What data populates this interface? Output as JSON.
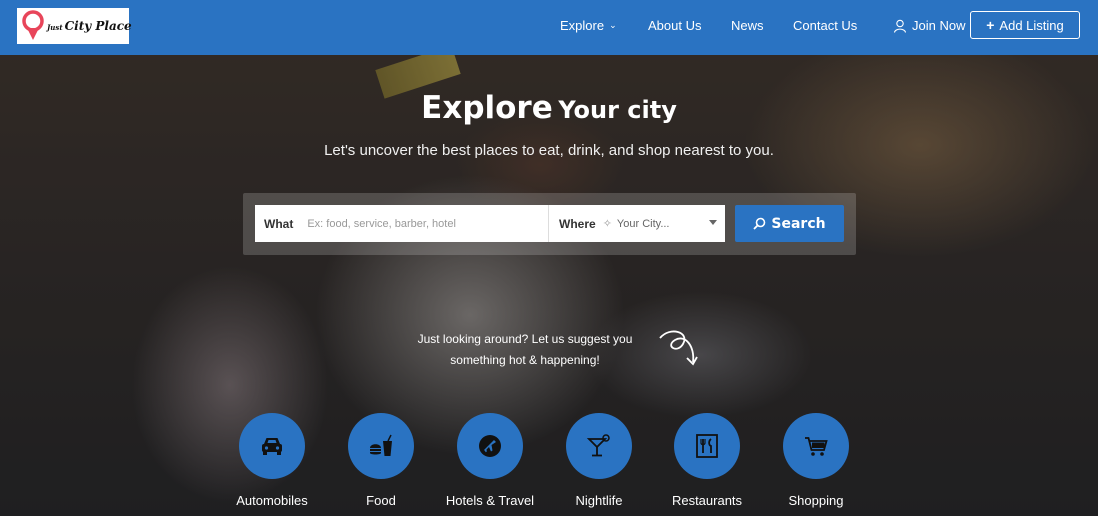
{
  "header": {
    "logo": {
      "small_text": "Just",
      "main_text": "City Place"
    },
    "nav": [
      {
        "label": "Explore"
      },
      {
        "label": "About Us"
      },
      {
        "label": "News"
      },
      {
        "label": "Contact Us"
      }
    ],
    "join_label": "Join Now",
    "add_listing_label": "Add Listing"
  },
  "hero": {
    "title_big": "Explore",
    "title_small": "Your city",
    "subtitle": "Let's uncover the best places to eat, drink, and shop nearest to you."
  },
  "search": {
    "what_label": "What",
    "what_placeholder": "Ex: food, service, barber, hotel",
    "where_label": "Where",
    "where_value": "Your City...",
    "button_label": "Search"
  },
  "suggest": {
    "line1": "Just looking around? Let us suggest you",
    "line2": "something hot & happening!"
  },
  "categories": [
    {
      "label": "Automobiles",
      "icon": "car-icon"
    },
    {
      "label": "Food",
      "icon": "burger-drink-icon"
    },
    {
      "label": "Hotels & Travel",
      "icon": "plane-icon"
    },
    {
      "label": "Nightlife",
      "icon": "cocktail-icon"
    },
    {
      "label": "Restaurants",
      "icon": "utensils-icon"
    },
    {
      "label": "Shopping",
      "icon": "cart-icon"
    }
  ],
  "colors": {
    "primary": "#2a73c2",
    "logo_pin": "#e8455a"
  }
}
